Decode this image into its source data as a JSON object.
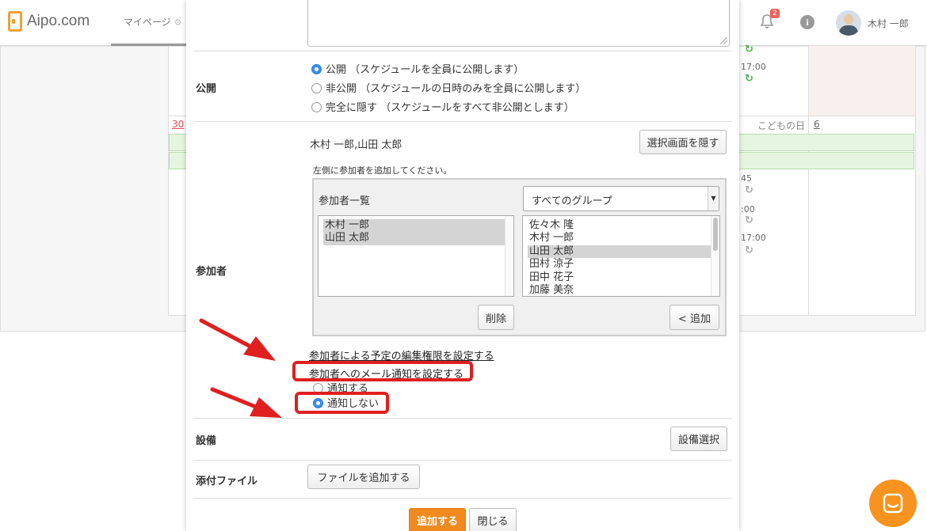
{
  "header": {
    "logo_text": "Aipo.com",
    "nav_mypage": "マイページ",
    "notification_count": "2",
    "user_name": "木村 一郎"
  },
  "calendar": {
    "date_30": "30",
    "holiday": "こどもの日",
    "date_6": "6",
    "times": [
      "17:00",
      "45",
      ":00",
      "17:00"
    ]
  },
  "modal": {
    "publish": {
      "label": "公開",
      "options": [
        {
          "text": "公開 （スケジュールを全員に公開します）",
          "checked": true
        },
        {
          "text": "非公開 （スケジュールの日時のみを全員に公開します）",
          "checked": false
        },
        {
          "text": "完全に隠す （スケジュールをすべて非公開とします）",
          "checked": false
        }
      ]
    },
    "participants": {
      "label": "参加者",
      "selected_names": "木村 一郎,山田 太郎",
      "hide_button": "選択画面を隠す",
      "hint": "左側に参加者を追加してください。",
      "list_title": "参加者一覧",
      "group_select": "すべてのグループ",
      "left_list": [
        "木村 一郎",
        "山田 太郎"
      ],
      "right_list": [
        "佐々木 隆",
        "木村 一郎",
        "山田 太郎",
        "田村 涼子",
        "田中 花子",
        "加藤 美奈"
      ],
      "right_selected_index": 2,
      "delete_button": "削除",
      "add_button": "< 追加",
      "edit_permission_link": "参加者による予定の編集権限を設定する",
      "mail_notify_link": "参加者へのメール通知を設定する",
      "notify_options": [
        {
          "text": "通知する",
          "checked": false
        },
        {
          "text": "通知しない",
          "checked": true
        }
      ]
    },
    "facility": {
      "label": "設備",
      "button": "設備選択"
    },
    "attachment": {
      "label": "添付ファイル",
      "button": "ファイルを追加する"
    },
    "footer": {
      "submit": "追加する",
      "close": "閉じる"
    }
  },
  "colors": {
    "accent_orange": "#f08a1e",
    "annotation_red": "#e01f1f",
    "radio_blue": "#3b8ef0"
  }
}
